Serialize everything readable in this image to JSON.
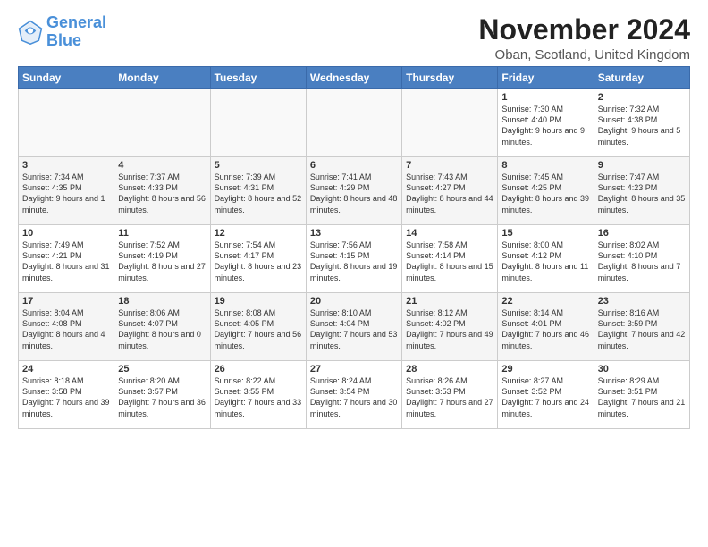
{
  "logo": {
    "line1": "General",
    "line2": "Blue"
  },
  "title": "November 2024",
  "location": "Oban, Scotland, United Kingdom",
  "days_of_week": [
    "Sunday",
    "Monday",
    "Tuesday",
    "Wednesday",
    "Thursday",
    "Friday",
    "Saturday"
  ],
  "weeks": [
    [
      {
        "day": "",
        "info": ""
      },
      {
        "day": "",
        "info": ""
      },
      {
        "day": "",
        "info": ""
      },
      {
        "day": "",
        "info": ""
      },
      {
        "day": "",
        "info": ""
      },
      {
        "day": "1",
        "info": "Sunrise: 7:30 AM\nSunset: 4:40 PM\nDaylight: 9 hours and 9 minutes."
      },
      {
        "day": "2",
        "info": "Sunrise: 7:32 AM\nSunset: 4:38 PM\nDaylight: 9 hours and 5 minutes."
      }
    ],
    [
      {
        "day": "3",
        "info": "Sunrise: 7:34 AM\nSunset: 4:35 PM\nDaylight: 9 hours and 1 minute."
      },
      {
        "day": "4",
        "info": "Sunrise: 7:37 AM\nSunset: 4:33 PM\nDaylight: 8 hours and 56 minutes."
      },
      {
        "day": "5",
        "info": "Sunrise: 7:39 AM\nSunset: 4:31 PM\nDaylight: 8 hours and 52 minutes."
      },
      {
        "day": "6",
        "info": "Sunrise: 7:41 AM\nSunset: 4:29 PM\nDaylight: 8 hours and 48 minutes."
      },
      {
        "day": "7",
        "info": "Sunrise: 7:43 AM\nSunset: 4:27 PM\nDaylight: 8 hours and 44 minutes."
      },
      {
        "day": "8",
        "info": "Sunrise: 7:45 AM\nSunset: 4:25 PM\nDaylight: 8 hours and 39 minutes."
      },
      {
        "day": "9",
        "info": "Sunrise: 7:47 AM\nSunset: 4:23 PM\nDaylight: 8 hours and 35 minutes."
      }
    ],
    [
      {
        "day": "10",
        "info": "Sunrise: 7:49 AM\nSunset: 4:21 PM\nDaylight: 8 hours and 31 minutes."
      },
      {
        "day": "11",
        "info": "Sunrise: 7:52 AM\nSunset: 4:19 PM\nDaylight: 8 hours and 27 minutes."
      },
      {
        "day": "12",
        "info": "Sunrise: 7:54 AM\nSunset: 4:17 PM\nDaylight: 8 hours and 23 minutes."
      },
      {
        "day": "13",
        "info": "Sunrise: 7:56 AM\nSunset: 4:15 PM\nDaylight: 8 hours and 19 minutes."
      },
      {
        "day": "14",
        "info": "Sunrise: 7:58 AM\nSunset: 4:14 PM\nDaylight: 8 hours and 15 minutes."
      },
      {
        "day": "15",
        "info": "Sunrise: 8:00 AM\nSunset: 4:12 PM\nDaylight: 8 hours and 11 minutes."
      },
      {
        "day": "16",
        "info": "Sunrise: 8:02 AM\nSunset: 4:10 PM\nDaylight: 8 hours and 7 minutes."
      }
    ],
    [
      {
        "day": "17",
        "info": "Sunrise: 8:04 AM\nSunset: 4:08 PM\nDaylight: 8 hours and 4 minutes."
      },
      {
        "day": "18",
        "info": "Sunrise: 8:06 AM\nSunset: 4:07 PM\nDaylight: 8 hours and 0 minutes."
      },
      {
        "day": "19",
        "info": "Sunrise: 8:08 AM\nSunset: 4:05 PM\nDaylight: 7 hours and 56 minutes."
      },
      {
        "day": "20",
        "info": "Sunrise: 8:10 AM\nSunset: 4:04 PM\nDaylight: 7 hours and 53 minutes."
      },
      {
        "day": "21",
        "info": "Sunrise: 8:12 AM\nSunset: 4:02 PM\nDaylight: 7 hours and 49 minutes."
      },
      {
        "day": "22",
        "info": "Sunrise: 8:14 AM\nSunset: 4:01 PM\nDaylight: 7 hours and 46 minutes."
      },
      {
        "day": "23",
        "info": "Sunrise: 8:16 AM\nSunset: 3:59 PM\nDaylight: 7 hours and 42 minutes."
      }
    ],
    [
      {
        "day": "24",
        "info": "Sunrise: 8:18 AM\nSunset: 3:58 PM\nDaylight: 7 hours and 39 minutes."
      },
      {
        "day": "25",
        "info": "Sunrise: 8:20 AM\nSunset: 3:57 PM\nDaylight: 7 hours and 36 minutes."
      },
      {
        "day": "26",
        "info": "Sunrise: 8:22 AM\nSunset: 3:55 PM\nDaylight: 7 hours and 33 minutes."
      },
      {
        "day": "27",
        "info": "Sunrise: 8:24 AM\nSunset: 3:54 PM\nDaylight: 7 hours and 30 minutes."
      },
      {
        "day": "28",
        "info": "Sunrise: 8:26 AM\nSunset: 3:53 PM\nDaylight: 7 hours and 27 minutes."
      },
      {
        "day": "29",
        "info": "Sunrise: 8:27 AM\nSunset: 3:52 PM\nDaylight: 7 hours and 24 minutes."
      },
      {
        "day": "30",
        "info": "Sunrise: 8:29 AM\nSunset: 3:51 PM\nDaylight: 7 hours and 21 minutes."
      }
    ]
  ]
}
